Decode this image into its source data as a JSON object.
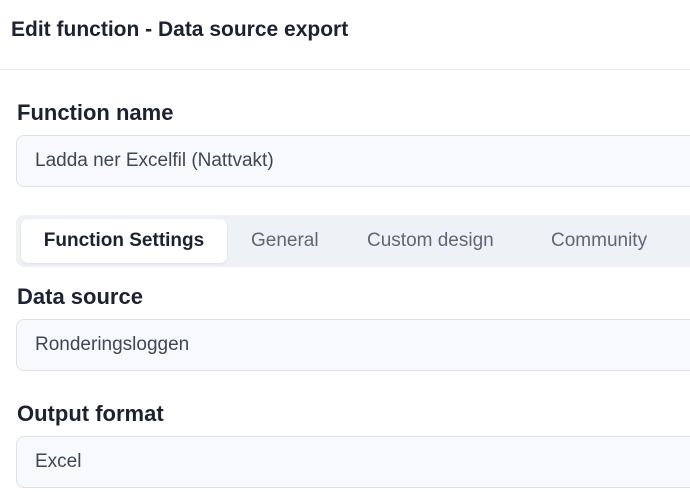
{
  "header": {
    "title": "Edit function - Data source export"
  },
  "function_name": {
    "label": "Function name",
    "value": "Ladda ner Excelfil (Nattvakt)"
  },
  "tabs": [
    {
      "label": "Function Settings",
      "active": true
    },
    {
      "label": "General",
      "active": false
    },
    {
      "label": "Custom design",
      "active": false
    },
    {
      "label": "Community",
      "active": false
    }
  ],
  "data_source": {
    "label": "Data source",
    "value": "Ronderingsloggen"
  },
  "output_format": {
    "label": "Output format",
    "value": "Excel"
  }
}
